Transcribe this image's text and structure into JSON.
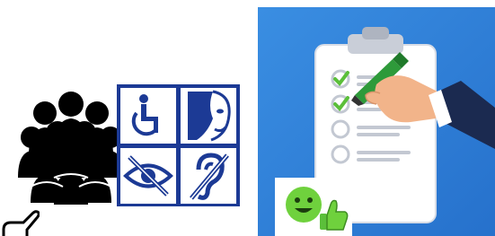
{
  "colors": {
    "background": "#ffffff",
    "accessibility_panel": "#1c3a95",
    "checklist_bg": "#2f7fd9",
    "check_green": "#5bbf3a",
    "smiley_green": "#6fd13d",
    "silhouette": "#000000"
  },
  "icons": [
    "people-group-icon",
    "wheelchair-icon",
    "sign-language-face-icon",
    "visual-impairment-eye-icon",
    "hearing-impairment-ear-icon",
    "clipboard-checklist-icon",
    "hand-with-marker-icon",
    "smiley-thumbs-up-icon",
    "pointing-hand-icon"
  ],
  "checklist": {
    "items": [
      {
        "checked": true
      },
      {
        "checked": true
      },
      {
        "checked": false
      },
      {
        "checked": false
      }
    ]
  }
}
